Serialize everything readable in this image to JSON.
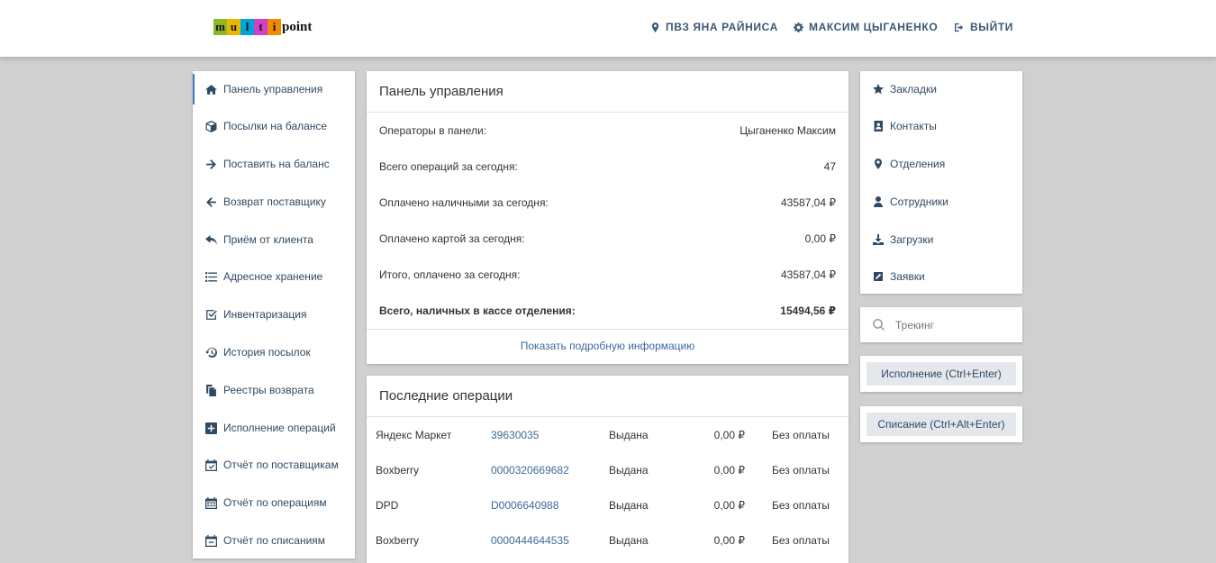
{
  "header": {
    "logo_letters": [
      "m",
      "u",
      "l",
      "t",
      "i"
    ],
    "logo_colors": [
      "#8bb827",
      "#e8b800",
      "#00a3d8",
      "#d53fc7",
      "#f08a00"
    ],
    "logo_word": "point",
    "location": "ПВЗ ЯНА РАЙНИСА",
    "user": "МАКСИМ ЦЫГАНЕНКО",
    "logout": "ВЫЙТИ"
  },
  "sidebar": {
    "items": [
      {
        "label": "Панель управления",
        "icon": "home-icon"
      },
      {
        "label": "Посылки на балансе",
        "icon": "cube-icon"
      },
      {
        "label": "Поставить на баланс",
        "icon": "arrow-right-icon"
      },
      {
        "label": "Возврат поставщику",
        "icon": "arrow-left-icon"
      },
      {
        "label": "Приём от клиента",
        "icon": "reply-icon"
      },
      {
        "label": "Адресное хранение",
        "icon": "list-icon"
      },
      {
        "label": "Инвентаризация",
        "icon": "checkbox-icon"
      },
      {
        "label": "История посылок",
        "icon": "history-icon"
      },
      {
        "label": "Реестры возврата",
        "icon": "copy-icon"
      },
      {
        "label": "Исполнение операций",
        "icon": "plus-square-icon"
      },
      {
        "label": "Отчёт по поставщикам",
        "icon": "calendar-check-icon"
      },
      {
        "label": "Отчёт по операциям",
        "icon": "calendar-icon"
      },
      {
        "label": "Отчёт по списаниям",
        "icon": "calendar-minus-icon"
      }
    ]
  },
  "dashboard": {
    "title": "Панель управления",
    "rows": [
      {
        "label": "Операторы в панели:",
        "value": "Цыганенко Максим"
      },
      {
        "label": "Всего операций за сегодня:",
        "value": "47"
      },
      {
        "label": "Оплачено наличными за сегодня:",
        "value": "43587,04 ₽"
      },
      {
        "label": "Оплачено картой за сегодня:",
        "value": "0,00 ₽"
      },
      {
        "label": "Итого, оплачено за сегодня:",
        "value": "43587,04 ₽"
      },
      {
        "label": "Всего, наличных в кассе отделения:",
        "value": "15494,56 ₽"
      }
    ],
    "more_link": "Показать подробную информацию"
  },
  "recent": {
    "title": "Последние операции",
    "rows": [
      {
        "sender": "Яндекс Маркет",
        "track": "39630035",
        "status": "Выдана",
        "amount": "0,00 ₽",
        "payment": "Без оплаты"
      },
      {
        "sender": "Boxberry",
        "track": "0000320669682",
        "status": "Выдана",
        "amount": "0,00 ₽",
        "payment": "Без оплаты"
      },
      {
        "sender": "DPD",
        "track": "D0006640988",
        "status": "Выдана",
        "amount": "0,00 ₽",
        "payment": "Без оплаты"
      },
      {
        "sender": "Boxberry",
        "track": "0000444644535",
        "status": "Выдана",
        "amount": "0,00 ₽",
        "payment": "Без оплаты"
      }
    ]
  },
  "rightnav": {
    "items": [
      {
        "label": "Закладки",
        "icon": "star-icon"
      },
      {
        "label": "Контакты",
        "icon": "address-book-icon"
      },
      {
        "label": "Отделения",
        "icon": "map-marker-icon"
      },
      {
        "label": "Сотрудники",
        "icon": "user-icon"
      },
      {
        "label": "Загрузки",
        "icon": "download-icon"
      },
      {
        "label": "Заявки",
        "icon": "edit-icon"
      }
    ]
  },
  "search": {
    "placeholder": "Трекинг"
  },
  "actions": {
    "execute": "Исполнение (Ctrl+Enter)",
    "writeoff": "Списание (Ctrl+Alt+Enter)"
  }
}
